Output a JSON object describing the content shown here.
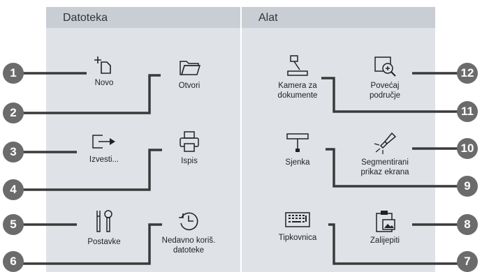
{
  "panels": {
    "file": {
      "title": "Datoteka",
      "items": {
        "new": "Novo",
        "open": "Otvori",
        "export": "Izvesti...",
        "print": "Ispis",
        "settings": "Postavke",
        "recent": "Nedavno koriš.\ndatoteke"
      }
    },
    "tools": {
      "title": "Alat",
      "items": {
        "document_camera": "Kamera za\ndokumente",
        "zoom": "Povećaj\npodručje",
        "shade": "Sjenka",
        "spotlight": "Segmentirani\nprikaz ekrana",
        "keyboard": "Tipkovnica",
        "paste": "Zalijepiti"
      }
    }
  },
  "callouts": [
    "1",
    "2",
    "3",
    "4",
    "5",
    "6",
    "7",
    "8",
    "9",
    "10",
    "11",
    "12"
  ],
  "colors": {
    "panel": "#dfe3e8",
    "header": "#c9ced5",
    "callout": "#6b6b6b"
  }
}
